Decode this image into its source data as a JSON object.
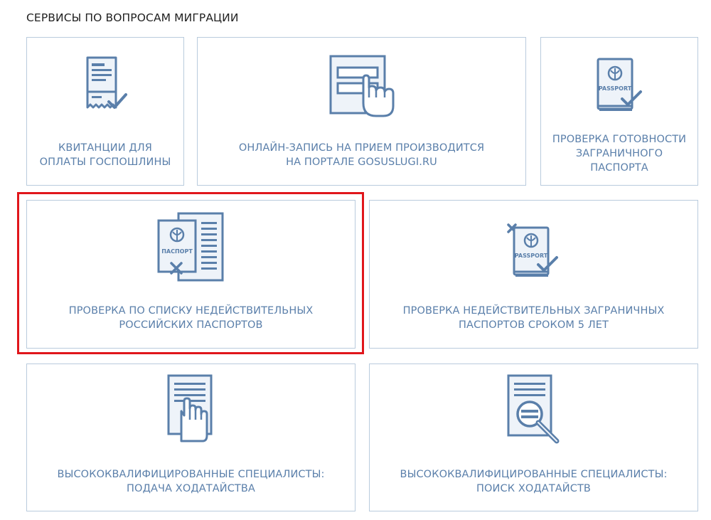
{
  "section": {
    "title": "СЕРВИСЫ ПО ВОПРОСАМ МИГРАЦИИ"
  },
  "colors": {
    "icon": "#5a7faa",
    "icon_fill": "#eef3f9",
    "border": "#b9cbdd",
    "highlight": "#e0161b"
  },
  "cards": [
    {
      "icon": "receipt-check-icon",
      "label_line1": "КВИТАНЦИИ ДЛЯ",
      "label_line2": "ОПЛАТЫ ГОСПОШЛИНЫ"
    },
    {
      "icon": "form-hand-click-icon",
      "label_line1": "ОНЛАЙН-ЗАПИСЬ НА ПРИЕМ ПРОИЗВОДИТСЯ",
      "label_line2": "НА ПОРТАЛЕ GOSUSLUGI.RU"
    },
    {
      "icon": "passport-check-icon",
      "icon_text": "PASSPORT",
      "label_line1": "ПРОВЕРКА ГОТОВНОСТИ",
      "label_line2": "ЗАГРАНИЧНОГО",
      "label_line3": "ПАСПОРТА"
    },
    {
      "icon": "passport-list-cross-icon",
      "icon_text": "ПАСПОРТ",
      "label_line1": "ПРОВЕРКА ПО СПИСКУ НЕДЕЙСТВИТЕЛЬНЫХ",
      "label_line2": "РОССИЙСКИХ ПАСПОРТОВ",
      "highlighted": true
    },
    {
      "icon": "passport-cross-check-icon",
      "icon_text": "PASSPORT",
      "label_line1": "ПРОВЕРКА НЕДЕЙСТВИТЕЛЬНЫХ ЗАГРАНИЧНЫХ",
      "label_line2": "ПАСПОРТОВ СРОКОМ 5 ЛЕТ"
    },
    {
      "icon": "document-hand-icon",
      "label_line1": "ВЫСОКОКВАЛИФИЦИРОВАННЫЕ СПЕЦИАЛИСТЫ:",
      "label_line2": "ПОДАЧА ХОДАТАЙСТВА"
    },
    {
      "icon": "document-magnifier-icon",
      "label_line1": "ВЫСОКОКВАЛИФИЦИРОВАННЫЕ СПЕЦИАЛИСТЫ:",
      "label_line2": "ПОИСК ХОДАТАЙСТВ"
    }
  ]
}
